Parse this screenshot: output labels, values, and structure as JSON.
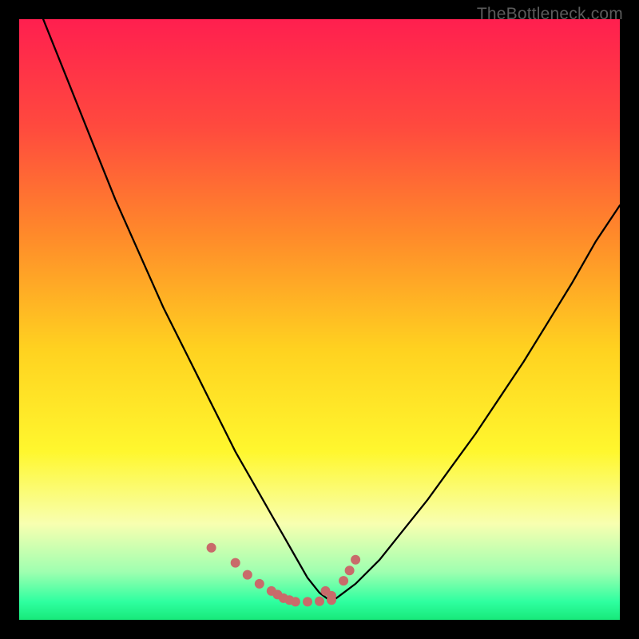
{
  "watermark": "TheBottleneck.com",
  "chart_data": {
    "type": "line",
    "title": "",
    "xlabel": "",
    "ylabel": "",
    "xlim": [
      0,
      100
    ],
    "ylim": [
      0,
      100
    ],
    "grid": false,
    "legend": false,
    "series": [
      {
        "name": "bottleneck-curve",
        "x": [
          4,
          8,
          12,
          16,
          20,
          24,
          28,
          30,
          32,
          34,
          36,
          38,
          40,
          42,
          44,
          46,
          48,
          50,
          52,
          56,
          60,
          64,
          68,
          72,
          76,
          80,
          84,
          88,
          92,
          96,
          100
        ],
        "y": [
          100,
          90,
          80,
          70,
          61,
          52,
          44,
          40,
          36,
          32,
          28,
          24.5,
          21,
          17.5,
          14,
          10.5,
          7,
          4.5,
          3,
          6,
          10,
          15,
          20,
          25.5,
          31,
          37,
          43,
          49.5,
          56,
          63,
          69
        ]
      }
    ],
    "markers": {
      "name": "highlight-dots",
      "x": [
        32,
        36,
        38,
        40,
        42,
        43,
        44,
        45,
        46,
        48,
        50,
        52,
        52,
        51,
        54,
        55,
        56
      ],
      "y": [
        12,
        9.5,
        7.5,
        6,
        4.8,
        4.2,
        3.6,
        3.3,
        3,
        3,
        3.1,
        3.3,
        4,
        4.8,
        6.5,
        8.2,
        10
      ],
      "color": "#c96a6a",
      "size": 12
    },
    "background_gradient": {
      "stops": [
        {
          "offset": 0.0,
          "color": "#ff1f4f"
        },
        {
          "offset": 0.18,
          "color": "#ff4a3e"
        },
        {
          "offset": 0.36,
          "color": "#ff8a2a"
        },
        {
          "offset": 0.55,
          "color": "#ffd220"
        },
        {
          "offset": 0.72,
          "color": "#fff72e"
        },
        {
          "offset": 0.84,
          "color": "#f8ffb0"
        },
        {
          "offset": 0.92,
          "color": "#9fffb0"
        },
        {
          "offset": 0.97,
          "color": "#2effa0"
        },
        {
          "offset": 1.0,
          "color": "#18e97a"
        }
      ]
    }
  }
}
